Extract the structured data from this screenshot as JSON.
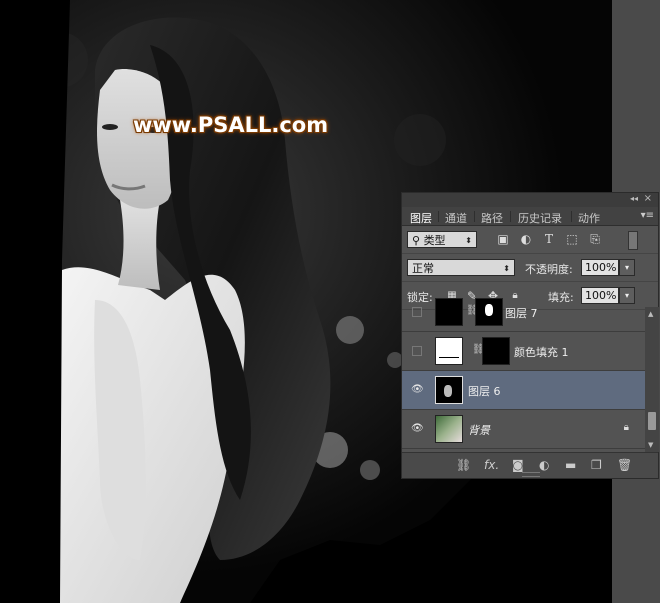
{
  "watermark": "www.PSALL.com",
  "panel": {
    "tabs": [
      "图层",
      "通道",
      "路径",
      "历史记录",
      "动作"
    ],
    "filter_kind": "类型",
    "blend_mode": "正常",
    "opacity_label": "不透明度:",
    "opacity_value": "100%",
    "lock_label": "锁定:",
    "fill_label": "填充:",
    "fill_value": "100%",
    "layers": [
      {
        "name": "图层 7",
        "visible": false,
        "selected": false
      },
      {
        "name": "颜色填充 1",
        "visible": false,
        "selected": false
      },
      {
        "name": "图层 6",
        "visible": true,
        "selected": true
      },
      {
        "name": "背景",
        "visible": true,
        "selected": false,
        "locked": true
      }
    ]
  }
}
